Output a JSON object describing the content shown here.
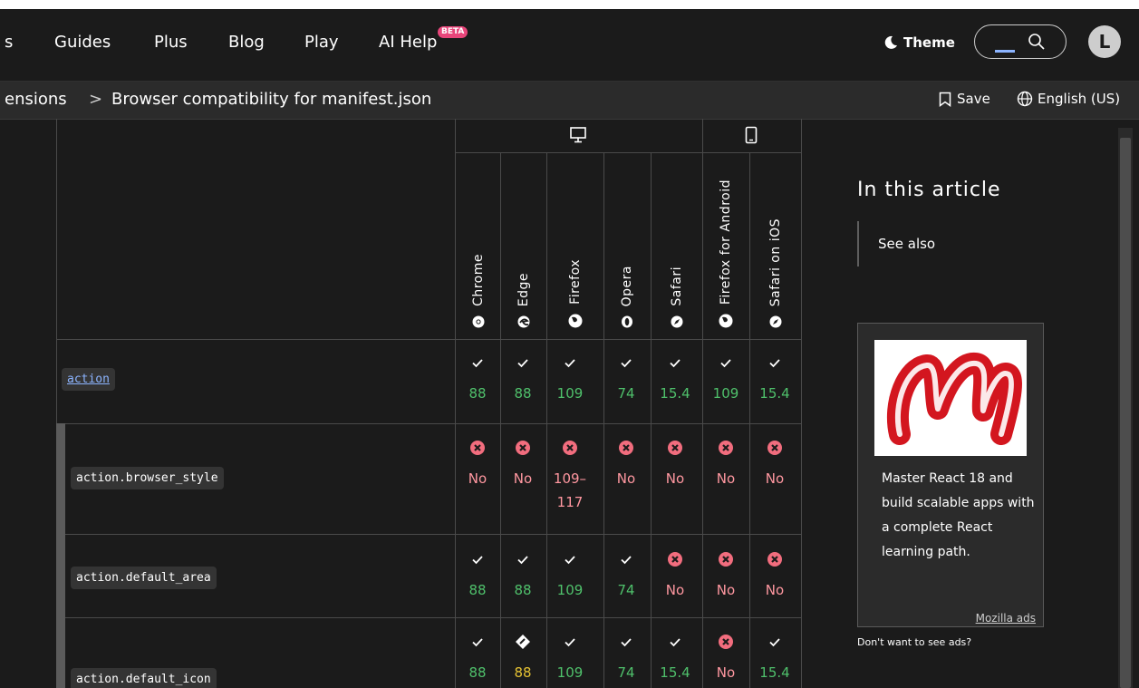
{
  "nav": {
    "partial_left": "s",
    "items": [
      "Guides",
      "Plus",
      "Blog",
      "Play"
    ],
    "ai_help": "AI Help",
    "beta_badge": "BETA",
    "theme_label": "Theme",
    "avatar_letter": "L"
  },
  "breadcrumb": {
    "parent": "ensions",
    "separator": ">",
    "current": "Browser compatibility for manifest.json",
    "save_label": "Save",
    "language_label": "English (US)"
  },
  "table": {
    "browsers": [
      "Chrome",
      "Edge",
      "Firefox",
      "Opera",
      "Safari",
      "Firefox for Android",
      "Safari on iOS"
    ],
    "rows": [
      {
        "feature": "action",
        "cells": [
          {
            "status": "yes",
            "value": "88"
          },
          {
            "status": "yes",
            "value": "88"
          },
          {
            "status": "yes",
            "value": "109"
          },
          {
            "status": "yes",
            "value": "74"
          },
          {
            "status": "yes",
            "value": "15.4"
          },
          {
            "status": "yes",
            "value": "109"
          },
          {
            "status": "yes",
            "value": "15.4"
          }
        ]
      },
      {
        "feature": "action.browser_style",
        "cells": [
          {
            "status": "no",
            "value": "No"
          },
          {
            "status": "no",
            "value": "No"
          },
          {
            "status": "no",
            "value": "109–",
            "value2": "117"
          },
          {
            "status": "no",
            "value": "No"
          },
          {
            "status": "no",
            "value": "No"
          },
          {
            "status": "no",
            "value": "No"
          },
          {
            "status": "no",
            "value": "No"
          }
        ]
      },
      {
        "feature": "action.default_area",
        "cells": [
          {
            "status": "yes",
            "value": "88"
          },
          {
            "status": "yes",
            "value": "88"
          },
          {
            "status": "yes",
            "value": "109"
          },
          {
            "status": "yes",
            "value": "74"
          },
          {
            "status": "no",
            "value": "No"
          },
          {
            "status": "no",
            "value": "No"
          },
          {
            "status": "no",
            "value": "No"
          }
        ]
      },
      {
        "feature": "action.default_icon",
        "cells": [
          {
            "status": "yes",
            "value": "88"
          },
          {
            "status": "partial",
            "value": "88"
          },
          {
            "status": "yes",
            "value": "109"
          },
          {
            "status": "yes",
            "value": "74"
          },
          {
            "status": "yes",
            "value": "15.4"
          },
          {
            "status": "no",
            "value": "No"
          },
          {
            "status": "yes",
            "value": "15.4"
          }
        ]
      }
    ]
  },
  "sidebar": {
    "toc_title": "In this article",
    "toc_items": [
      "See also"
    ],
    "ad_text": "Master React 18 and build scalable apps with a complete React learning path.",
    "ad_link": "Mozilla ads",
    "no_ads": "Don't want to see ads?"
  },
  "colors": {
    "background": "#1b1b1b",
    "supported": "#4fc06b",
    "unsupported": "#ff97a0",
    "partial": "#e5c233",
    "no_icon_bg": "#f26d7e",
    "beta_badge": "#e9467b"
  }
}
